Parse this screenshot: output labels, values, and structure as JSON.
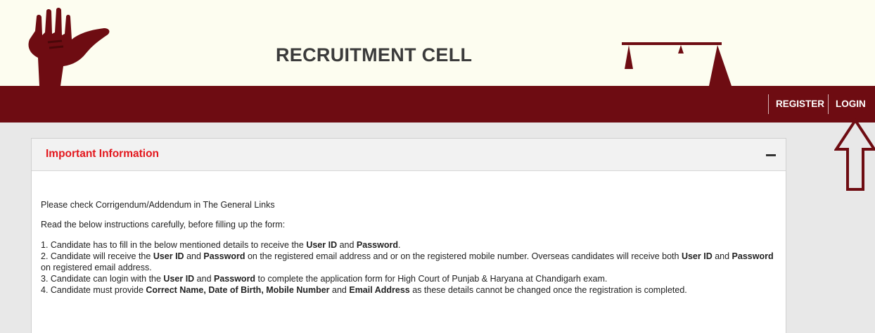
{
  "header": {
    "title": "RECRUITMENT CELL",
    "brand_color": "#6e0c12",
    "logo_left_icon": "open-hand-emblem-icon",
    "logo_right_icon": "scales-emblem-icon"
  },
  "nav": {
    "register": "REGISTER",
    "login": "LOGIN",
    "highlight_icon": "up-arrow-outline-icon"
  },
  "panel": {
    "title": "Important Information",
    "title_color": "#e3171d",
    "toggle_icon": "minus-icon",
    "notice": "Please check Corrigendum/Addendum in The General Links",
    "read_line": "Read the below instructions carefully, before filling up the form:",
    "instructions": {
      "i1": {
        "a": "1. Candidate has to fill in the below mentioned details to receive the ",
        "b1": "User ID",
        "c": " and ",
        "b2": "Password",
        "d": "."
      },
      "i2": {
        "a": "2. Candidate will receive the ",
        "b1": "User ID",
        "c": " and ",
        "b2": "Password",
        "d": " on the registered email address and or on the registered mobile number. Overseas candidates will receive both ",
        "b3": "User ID",
        "e": " and ",
        "b4": "Password",
        "f": " on registered email address."
      },
      "i3": {
        "a": "3. Candidate can login with the ",
        "b1": "User ID",
        "c": " and ",
        "b2": "Password",
        "d": " to complete the application form for High Court of Punjab & Haryana at Chandigarh exam."
      },
      "i4": {
        "a": "4. Candidate must provide ",
        "b1": "Correct Name, Date of Birth, Mobile Number",
        "c": " and ",
        "b2": "Email Address",
        "d": " as these details cannot be changed once the registration is completed."
      }
    }
  }
}
